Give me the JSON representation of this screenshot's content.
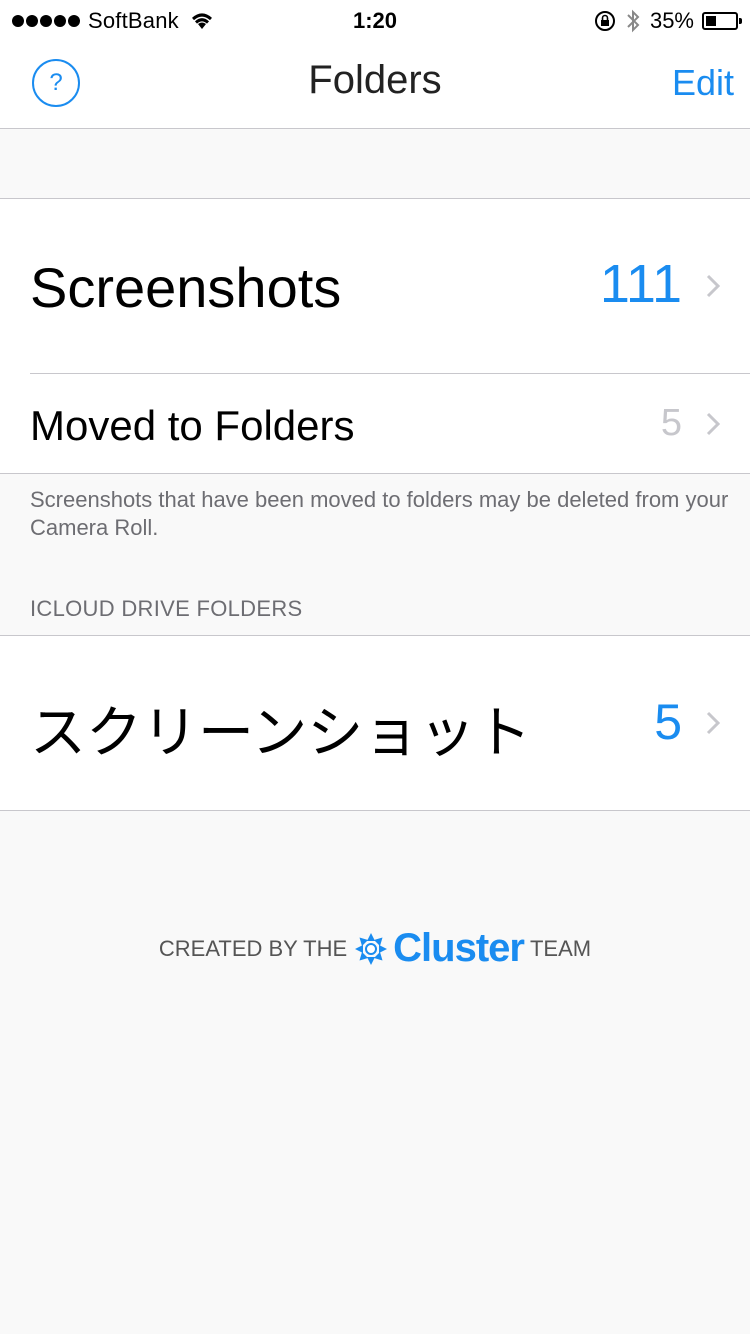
{
  "status_bar": {
    "carrier": "SoftBank",
    "time": "1:20",
    "battery_percent": "35%",
    "battery_level": 0.35,
    "icons": [
      "signal-dots",
      "wifi-icon",
      "rotation-lock-icon",
      "bluetooth-icon",
      "battery-icon"
    ]
  },
  "nav": {
    "help_label": "?",
    "title": "Folders",
    "edit_label": "Edit"
  },
  "folders": [
    {
      "label": "Screenshots",
      "count": "111"
    },
    {
      "label": "Moved to Folders",
      "count": "5"
    }
  ],
  "footnote": "Screenshots that have been moved to folders may be deleted from your Camera Roll.",
  "icloud": {
    "header": "ICLOUD DRIVE FOLDERS",
    "folders": [
      {
        "label": "スクリーンショット",
        "count": "5"
      }
    ]
  },
  "credit": {
    "prefix": "CREATED BY THE",
    "brand": "Cluster",
    "suffix": "TEAM"
  },
  "colors": {
    "accent": "#1a8cf0",
    "secondary_text": "#6d6d72",
    "separator": "#c8c7cc",
    "background": "#f9f9f9"
  }
}
